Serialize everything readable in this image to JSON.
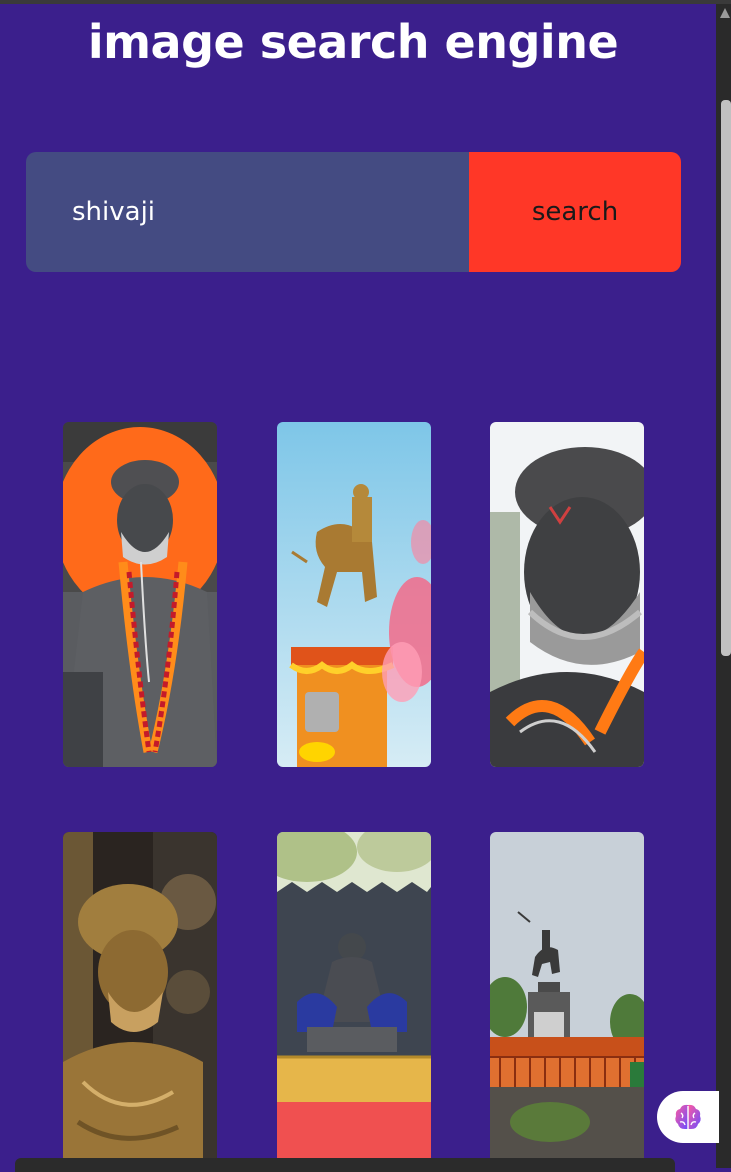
{
  "header": {
    "title": "image search engine"
  },
  "search": {
    "value": "shivaji",
    "button_label": "search"
  },
  "results": [
    {
      "name": "statue-portrait-orange"
    },
    {
      "name": "equestrian-statue-flowers"
    },
    {
      "name": "statue-closeup-face"
    },
    {
      "name": "golden-statue-carved"
    },
    {
      "name": "seated-statue-fort"
    },
    {
      "name": "equestrian-statue-monument"
    }
  ],
  "floating": {
    "icon": "brain-icon"
  },
  "bottom_bar": {
    "text": ""
  },
  "colors": {
    "background": "#3b1f8c",
    "search_field": "#444b82",
    "search_button": "#ff3727"
  }
}
